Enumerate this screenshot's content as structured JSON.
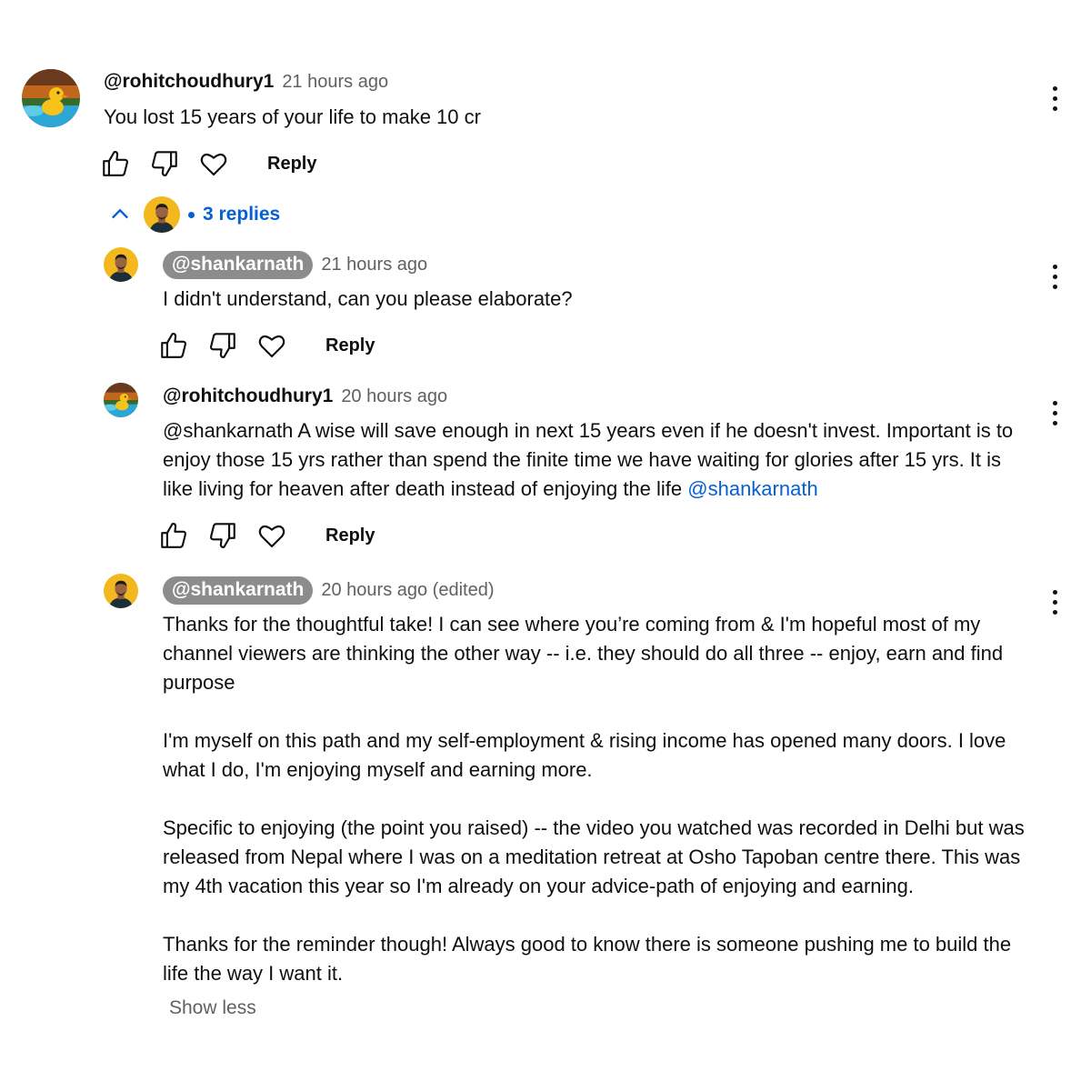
{
  "comments": [
    {
      "author": "@rohitchoudhury1",
      "time": "21 hours ago",
      "text": "You lost 15 years of your life to make 10 cr",
      "reply_label": "Reply"
    }
  ],
  "replies_toggle": {
    "label": "3 replies"
  },
  "replies": [
    {
      "author": "@shankarnath",
      "time": "21 hours ago",
      "text": "I didn't understand, can you please elaborate?",
      "reply_label": "Reply"
    },
    {
      "author": "@rohitchoudhury1",
      "time": "20 hours ago",
      "text_prefix": "@shankarnath  A wise will save enough in next 15 years even if he doesn't invest. Important is to enjoy those 15 yrs rather than spend the finite time we have waiting for glories after 15 yrs. It is like living for heaven after death instead of enjoying the life ",
      "mention": "@shankarnath",
      "reply_label": "Reply"
    },
    {
      "author": "@shankarnath",
      "time": "20 hours ago (edited)",
      "paragraphs": [
        "Thanks for the thoughtful take! I can see where you’re coming from & I'm hopeful most of my channel viewers are thinking the other way -- i.e. they should do all three -- enjoy, earn and find purpose",
        "I'm myself on this path and my self-employment & rising income has opened many doors. I love what I do, I'm enjoying myself and earning more.",
        "Specific to enjoying (the point you raised) -- the video you watched was recorded in Delhi but was released from Nepal where I was on a meditation retreat at Osho Tapoban centre there. This was my 4th vacation this year so I'm already on your advice-path of enjoying and earning.",
        "Thanks for the reminder though! Always good to know there is someone pushing me to build the life the way I want it."
      ],
      "show_less": "Show less"
    }
  ],
  "icons": [
    "thumbs-up-icon",
    "thumbs-down-icon",
    "heart-icon",
    "more-vert-icon",
    "chevron-up-icon"
  ],
  "colors": {
    "link": "#065fd4",
    "chip": "#8c8c8c",
    "meta": "#606060"
  }
}
